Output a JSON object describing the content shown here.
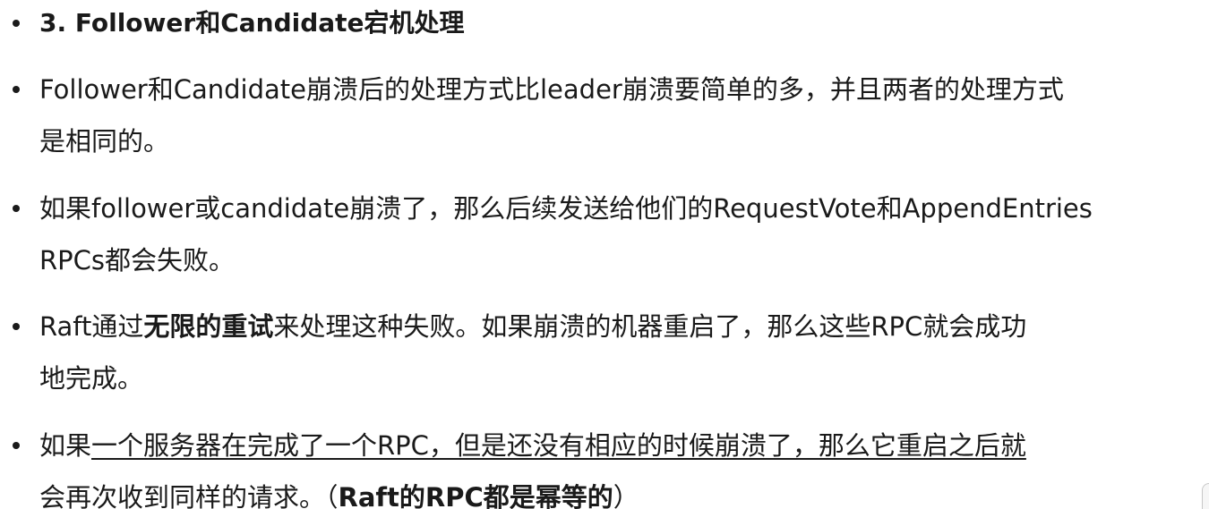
{
  "heading": {
    "text": "3. Follower和Candidate宕机处理"
  },
  "bullets": [
    {
      "line1": "Follower和Candidate崩溃后的处理方式比leader崩溃要简单的多，并且两者的处理方式",
      "line2": "是相同的。"
    },
    {
      "line1": "如果follower或candidate崩溃了，那么后续发送给他们的RequestVote和AppendEntries",
      "line2": "RPCs都会失败。"
    },
    {
      "line1_pre": "Raft通过",
      "line1_bold": "无限的重试",
      "line1_post": "来处理这种失败。如果崩溃的机器重启了，那么这些RPC就会成功",
      "line2": "地完成。"
    },
    {
      "line1_pre": "如果",
      "line1_underlined": "一个服务器在完成了一个RPC，但是还没有相应的时候崩溃了，那么它重启之后就",
      "line2_pre": "会再次收到同样的请求。（",
      "line2_bold": "Raft的RPC都是幂等的",
      "line2_post": "）"
    }
  ]
}
